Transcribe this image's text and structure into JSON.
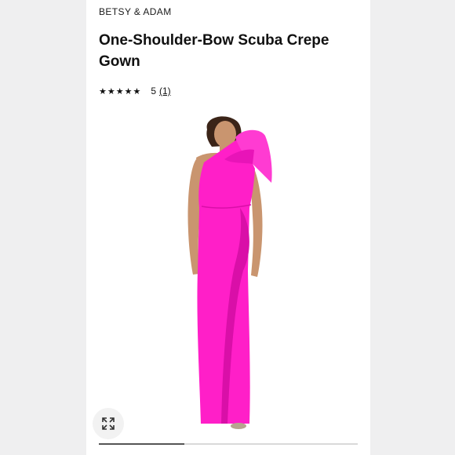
{
  "product": {
    "brand": "BETSY & ADAM",
    "title": "One-Shoulder-Bow Scuba Crepe Gown",
    "rating_stars": "★★★★★",
    "rating_value": "5",
    "rating_count": "(1)"
  },
  "gallery": {
    "image_colors": {
      "dress": "#ff1fc8",
      "dress_shadow": "#d90fa8",
      "skin": "#c9956f",
      "hair": "#3b2418"
    },
    "expand_icon": "expand-arrows-icon",
    "progress_fraction": 0.33
  }
}
